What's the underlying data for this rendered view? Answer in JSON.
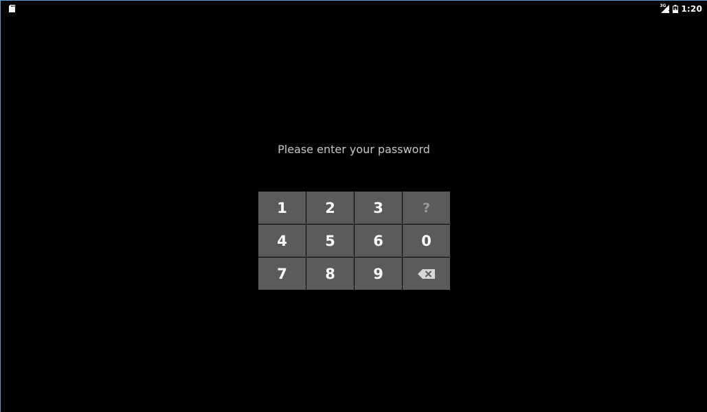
{
  "status_bar": {
    "network_label": "3G",
    "time": "1:20"
  },
  "prompt": "Please enter your password",
  "keypad": {
    "keys": [
      {
        "label": "1",
        "type": "digit"
      },
      {
        "label": "2",
        "type": "digit"
      },
      {
        "label": "3",
        "type": "digit"
      },
      {
        "label": "?",
        "type": "help"
      },
      {
        "label": "4",
        "type": "digit"
      },
      {
        "label": "5",
        "type": "digit"
      },
      {
        "label": "6",
        "type": "digit"
      },
      {
        "label": "0",
        "type": "digit"
      },
      {
        "label": "7",
        "type": "digit"
      },
      {
        "label": "8",
        "type": "digit"
      },
      {
        "label": "9",
        "type": "digit"
      },
      {
        "icon": "backspace-icon",
        "type": "backspace"
      }
    ]
  },
  "colors": {
    "background": "#000000",
    "key_background": "#5b5b5b",
    "key_text": "#ffffff",
    "help_key_text": "#9a9a9a",
    "prompt_text": "#c8c8c8"
  }
}
